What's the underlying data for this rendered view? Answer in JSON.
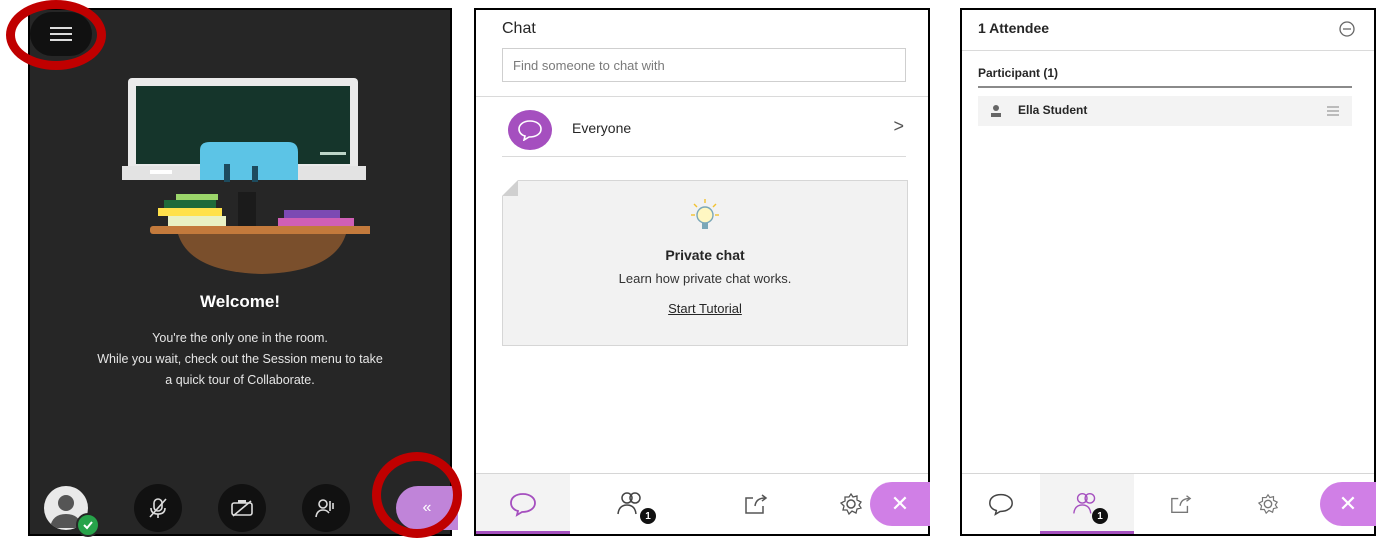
{
  "session": {
    "welcome_title": "Welcome!",
    "welcome_text_1": "You're the only one in the room.",
    "welcome_text_2": "While you wait, check out the Session menu to take",
    "welcome_text_3": "a quick tour of Collaborate.",
    "collapse_glyph": "«",
    "icons": [
      "menu-icon",
      "avatar-icon",
      "microphone-off-icon",
      "camera-off-icon",
      "share-hand-icon",
      "collapse-panel-icon"
    ],
    "highlight_color": "#c00000"
  },
  "chat": {
    "title": "Chat",
    "search_placeholder": "Find someone to chat with",
    "everyone_label": "Everyone",
    "chevron": ">",
    "tutorial": {
      "title": "Private chat",
      "text": "Learn how private chat works.",
      "link": "Start Tutorial"
    }
  },
  "attendees": {
    "title": "1 Attendee",
    "section_label": "Participant (1)",
    "list": [
      {
        "name": "Ella Student"
      }
    ]
  },
  "tabbar": {
    "tabs": [
      "chat-icon",
      "attendees-icon",
      "share-content-icon",
      "settings-icon"
    ],
    "attendee_badge": "1",
    "close_glyph": "✕"
  },
  "colors": {
    "accent_purple": "#a54fbf",
    "close_purple": "#d07fe6",
    "panel_dark": "#262626"
  }
}
